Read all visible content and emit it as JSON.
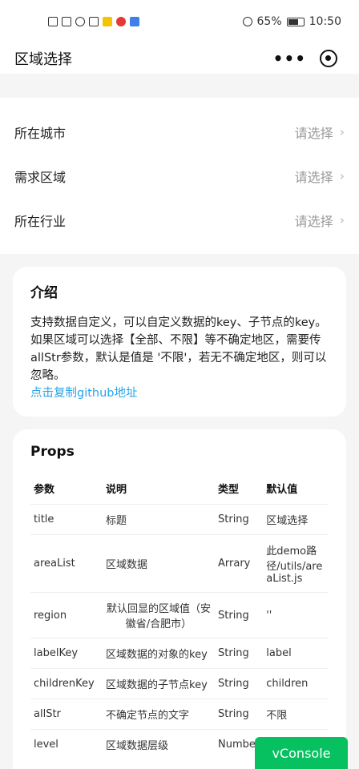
{
  "status_bar": {
    "battery": "65%",
    "time": "10:50"
  },
  "nav": {
    "title": "区域选择"
  },
  "form": {
    "rows": [
      {
        "label": "所在城市",
        "value": "请选择"
      },
      {
        "label": "需求区域",
        "value": "请选择"
      },
      {
        "label": "所在行业",
        "value": "请选择"
      }
    ]
  },
  "intro": {
    "title": "介绍",
    "text": "支持数据自定义，可以自定义数据的key、子节点的key。如果区域可以选择【全部、不限】等不确定地区，需要传allStr参数，默认是值是 '不限'，若无不确定地区，则可以忽略。",
    "link": "点击复制github地址"
  },
  "props": {
    "title": "Props",
    "headers": [
      "参数",
      "说明",
      "类型",
      "默认值"
    ],
    "rows": [
      [
        "title",
        "标题",
        "String",
        "区域选择"
      ],
      [
        "areaList",
        "区域数据",
        "Arrary",
        "此demo路径/utils/areaList.js"
      ],
      [
        "region",
        "默认回显的区域值（安徽省/合肥市）",
        "String",
        "''"
      ],
      [
        "labelKey",
        "区域数据的对象的key",
        "String",
        "label"
      ],
      [
        "childrenKey",
        "区域数据的子节点key",
        "String",
        "children"
      ],
      [
        "allStr",
        "不确定节点的文字",
        "String",
        "不限"
      ],
      [
        "level",
        "区域数据层级",
        "Number",
        ""
      ]
    ]
  },
  "vconsole": {
    "label": "vConsole"
  },
  "colors": {
    "accent_link": "#2aa4e8",
    "vconsole_green": "#07c160"
  }
}
